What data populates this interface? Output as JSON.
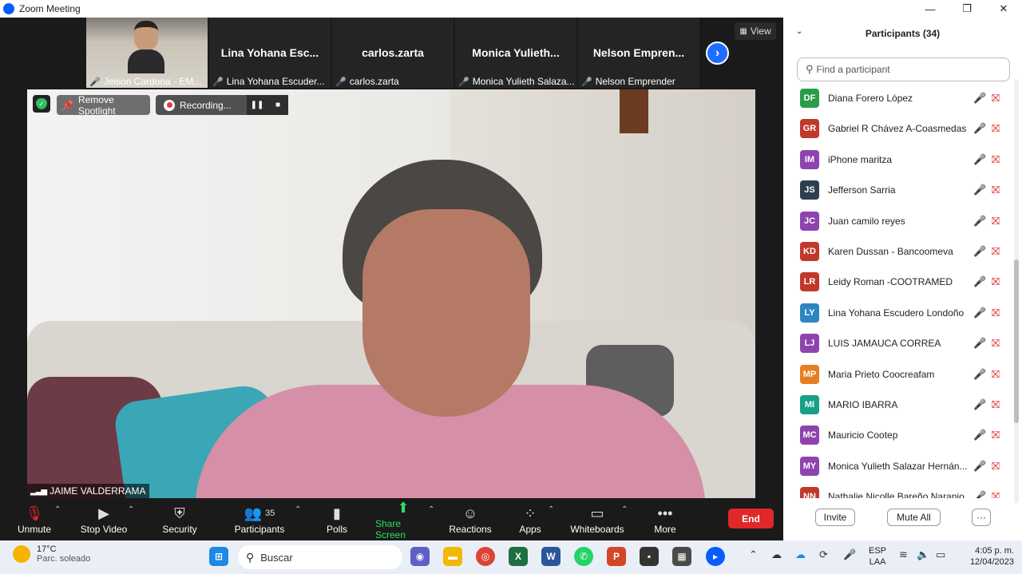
{
  "window": {
    "title": "Zoom Meeting",
    "minimize": "—",
    "maximize": "❐",
    "close": "✕"
  },
  "strip": {
    "tiles": [
      {
        "big": "",
        "small": "Jeison Cardona - EM..."
      },
      {
        "big": "Lina Yohana Esc...",
        "small": "Lina Yohana Escuder..."
      },
      {
        "big": "carlos.zarta",
        "small": "carlos.zarta"
      },
      {
        "big": "Monica Yulieth...",
        "small": "Monica Yulieth Salaza..."
      },
      {
        "big": "Nelson Empren...",
        "small": "Nelson Emprender"
      }
    ],
    "view_label": "View"
  },
  "spotlight": {
    "remove_label": "Remove Spotlight",
    "recording_label": "Recording...",
    "speaker_name": "JAIME VALDERRAMA"
  },
  "toolbar": {
    "unmute": "Unmute",
    "stop_video": "Stop Video",
    "security": "Security",
    "participants": "Participants",
    "participants_count": "35",
    "polls": "Polls",
    "share_screen": "Share Screen",
    "reactions": "Reactions",
    "apps": "Apps",
    "whiteboards": "Whiteboards",
    "more": "More",
    "end": "End"
  },
  "panel": {
    "title": "Participants (34)",
    "search_placeholder": "Find a participant",
    "participants": [
      {
        "initials": "DF",
        "name": "Diana Forero López",
        "color": "#2a9d4a"
      },
      {
        "initials": "GR",
        "name": "Gabriel R Chávez A-Coasmedas",
        "color": "#c0392b"
      },
      {
        "initials": "IM",
        "name": "iPhone maritza",
        "color": "#8e44ad"
      },
      {
        "initials": "JS",
        "name": "Jefferson Sarria",
        "color": "#2c3e50"
      },
      {
        "initials": "JC",
        "name": "Juan camilo reyes",
        "color": "#8e44ad"
      },
      {
        "initials": "KD",
        "name": "Karen Dussan - Bancoomeva",
        "color": "#c0392b"
      },
      {
        "initials": "LR",
        "name": "Leidy Roman -COOTRAMED",
        "color": "#c0392b"
      },
      {
        "initials": "LY",
        "name": "Lina Yohana Escudero Londoño",
        "color": "#2e86c1"
      },
      {
        "initials": "LJ",
        "name": "LUIS JAMAUCA CORREA",
        "color": "#8e44ad"
      },
      {
        "initials": "MP",
        "name": "Maria Prieto Coocreafam",
        "color": "#e67e22"
      },
      {
        "initials": "MI",
        "name": "MARIO IBARRA",
        "color": "#16a085"
      },
      {
        "initials": "MC",
        "name": "Mauricio Cootep",
        "color": "#8e44ad"
      },
      {
        "initials": "MY",
        "name": "Monica Yulieth Salazar Hernán...",
        "color": "#8e44ad"
      },
      {
        "initials": "NN",
        "name": "Nathalie Nicolle Bareño Naranjo",
        "color": "#c0392b"
      }
    ],
    "invite": "Invite",
    "mute_all": "Mute All",
    "more": "···"
  },
  "taskbar": {
    "temp": "17°C",
    "weather": "Parc. soleado",
    "search": "Buscar",
    "lang1": "ESP",
    "lang2": "LAA",
    "time": "4:05 p. m.",
    "date": "12/04/2023"
  }
}
